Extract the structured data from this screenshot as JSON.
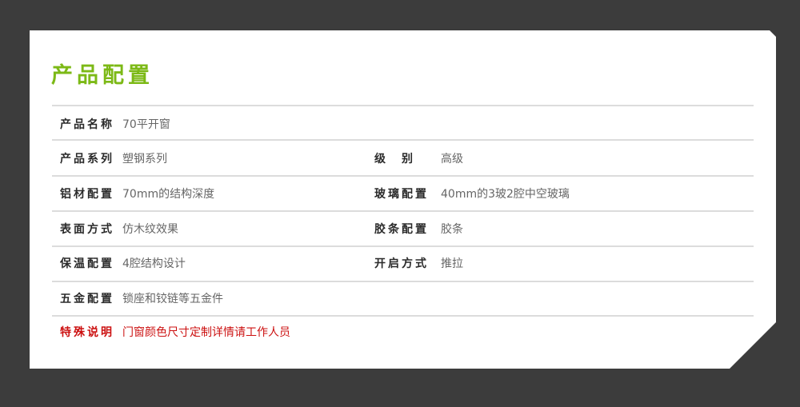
{
  "title": "产品配置",
  "rows": [
    {
      "l1": "产品名称",
      "v1": "70平开窗"
    },
    {
      "l1": "产品系列",
      "v1": "塑钢系列",
      "l2": "级　别",
      "v2": "高级"
    },
    {
      "l1": "铝材配置",
      "v1": "70mm的结构深度",
      "l2": "玻璃配置",
      "v2": "40mm的3玻2腔中空玻璃"
    },
    {
      "l1": "表面方式",
      "v1": "仿木纹效果",
      "l2": "胶条配置",
      "v2": "胶条"
    },
    {
      "l1": "保温配置",
      "v1": "4腔结构设计",
      "l2": "开启方式",
      "v2": "推拉"
    },
    {
      "l1": "五金配置",
      "v1": "锁座和铰链等五金件"
    }
  ],
  "note": {
    "label": "特殊说明",
    "text": "门窗颜色尺寸定制详情请工作人员"
  },
  "colors": {
    "accent": "#7cb916",
    "note": "#cc1111",
    "background": "#3c3c3c"
  }
}
